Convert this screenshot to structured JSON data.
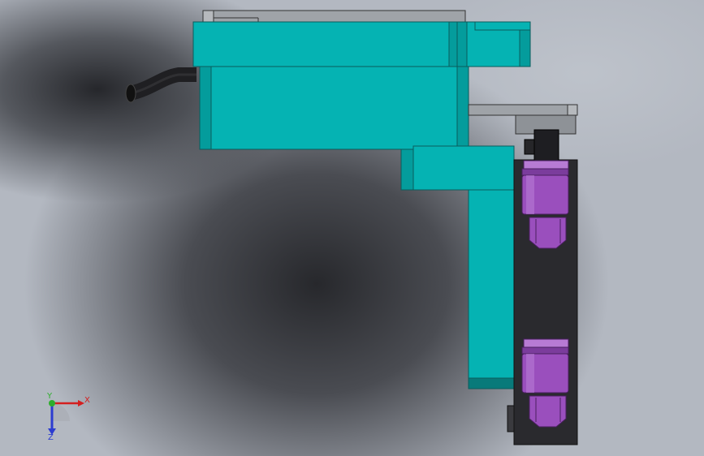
{
  "viewport": {
    "triad": {
      "x_label": "X",
      "y_label": "Y",
      "z_label": "Z"
    }
  },
  "colors": {
    "teal_body": "#05b3b3",
    "teal_edge": "#0a7f7f",
    "teal_dark": "#087a7a",
    "gray_plate": "#9fa3a8",
    "black_block": "#2a2a2e",
    "purple_nozzle": "#9a4fbd",
    "purple_dark": "#6d2f8a",
    "hose": "#1f1f22",
    "axis_x": "#d41f1f",
    "axis_y": "#2dae2d",
    "axis_z": "#2c3cd0"
  },
  "icons": [
    "hose-icon",
    "nozzle-icon",
    "axis-triad-icon"
  ]
}
